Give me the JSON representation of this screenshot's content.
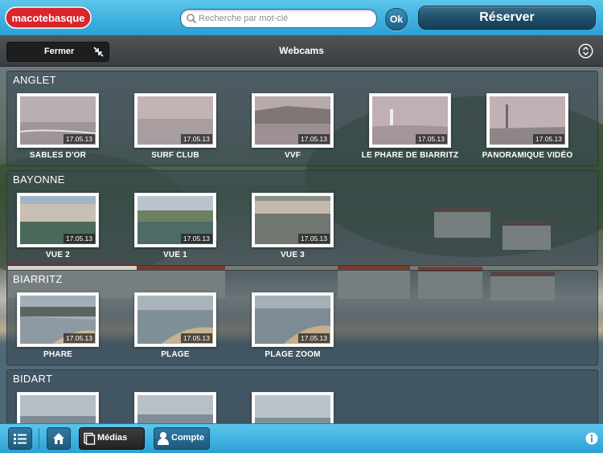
{
  "header": {
    "logo_text": "macotebasque",
    "search_placeholder": "Recherche par mot-clé",
    "ok_label": "Ok",
    "reserve_label": "Réserver"
  },
  "subbar": {
    "close_label": "Fermer",
    "title": "Webcams"
  },
  "sections": [
    {
      "title": "ANGLET",
      "cams": [
        {
          "name": "SABLES D'OR",
          "date": "17.05.13"
        },
        {
          "name": "SURF CLUB",
          "date": "17.05.13"
        },
        {
          "name": "VVF",
          "date": "17.05.13"
        },
        {
          "name": "LE PHARE DE BIARRITZ",
          "date": "17.05.13"
        },
        {
          "name": "PANORAMIQUE VIDÉO",
          "date": "17.05.13"
        }
      ]
    },
    {
      "title": "BAYONNE",
      "cams": [
        {
          "name": "VUE 2",
          "date": "17.05.13"
        },
        {
          "name": "VUE 1",
          "date": "17.05.13"
        },
        {
          "name": "VUE 3",
          "date": "17.05.13"
        }
      ]
    },
    {
      "title": "BIARRITZ",
      "cams": [
        {
          "name": "PHARE",
          "date": "17.05.13"
        },
        {
          "name": "PLAGE",
          "date": "17.05.13"
        },
        {
          "name": "PLAGE ZOOM",
          "date": "17.05.13"
        }
      ]
    },
    {
      "title": "BIDART",
      "cams": []
    }
  ],
  "bottombar": {
    "medias_label": "Médias",
    "account_label": "Compte"
  },
  "colors": {
    "accent": "#2aa0d4",
    "dark_button": "#1d4c66"
  }
}
